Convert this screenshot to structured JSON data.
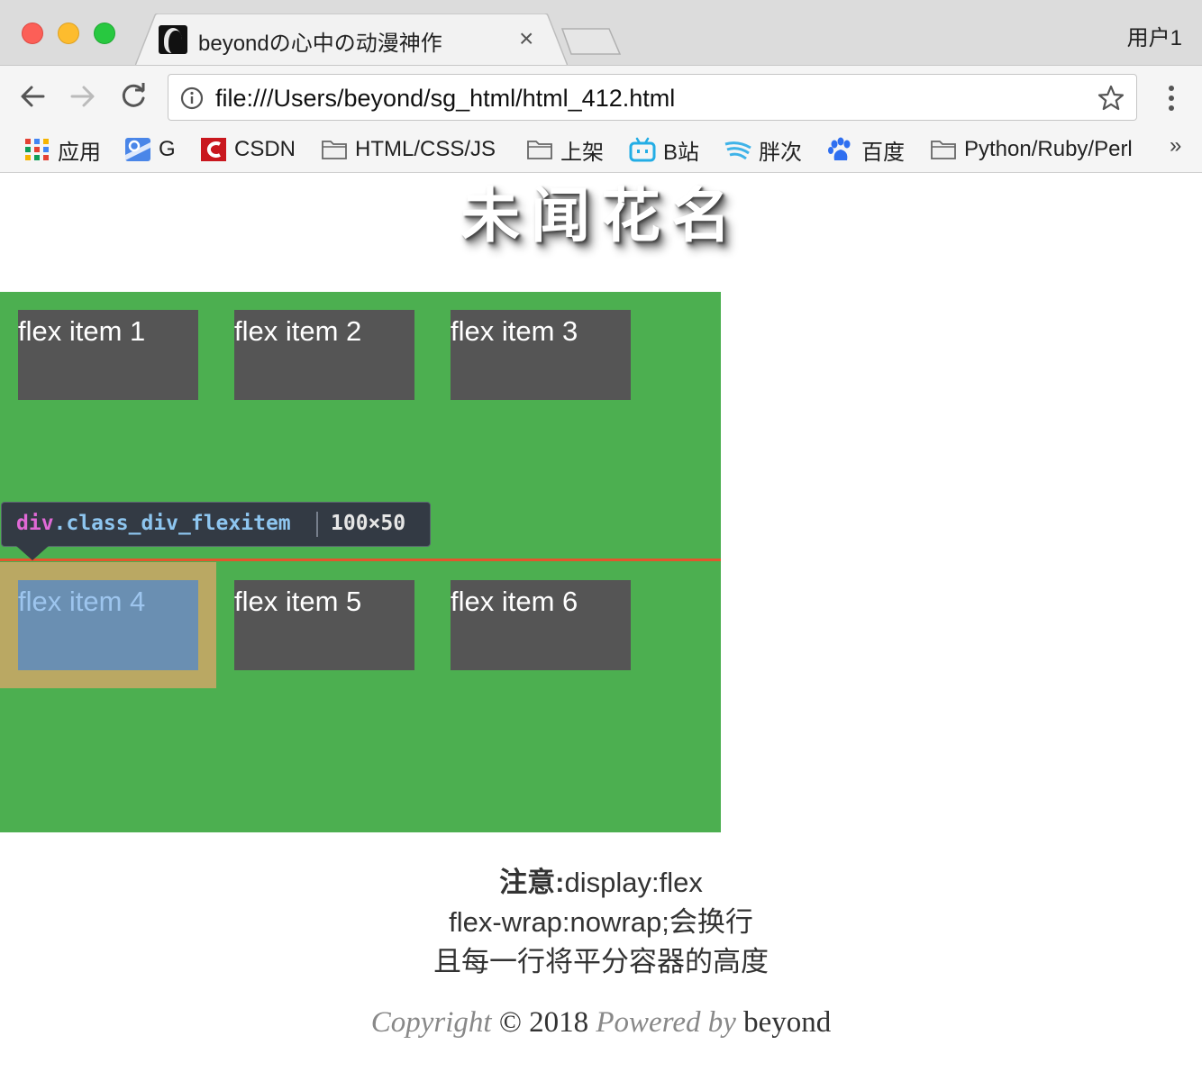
{
  "browser": {
    "tab_title": "beyondの心中の动漫神作",
    "tab_close_glyph": "×",
    "profile_name": "用户1",
    "url": "file:///Users/beyond/sg_html/html_412.html",
    "more_bookmarks_glyph": "»",
    "bookmarks": [
      {
        "label": "应用",
        "icon": "apps-grid-icon"
      },
      {
        "label": "G",
        "icon": "google-maps-icon"
      },
      {
        "label": "CSDN",
        "icon": "csdn-icon"
      },
      {
        "label": "HTML/CSS/JS",
        "icon": "folder-icon"
      },
      {
        "label": "上架",
        "icon": "folder-icon"
      },
      {
        "label": "B站",
        "icon": "bilibili-icon"
      },
      {
        "label": "胖次",
        "icon": "wave-icon"
      },
      {
        "label": "百度",
        "icon": "baidu-paw-icon"
      },
      {
        "label": "Python/Ruby/Perl",
        "icon": "folder-icon"
      }
    ]
  },
  "page": {
    "title": "未闻花名",
    "flex_items": [
      {
        "label": "flex item 1"
      },
      {
        "label": "flex item 2"
      },
      {
        "label": "flex item 3"
      },
      {
        "label": "flex item 4"
      },
      {
        "label": "flex item 5"
      },
      {
        "label": "flex item 6"
      }
    ],
    "tooltip": {
      "tag": "div",
      "class_name": ".class_div_flexitem",
      "size": "100×50"
    },
    "note": {
      "label": "注意:",
      "line1_rest": "display:flex",
      "line2": "flex-wrap:nowrap;会换行",
      "line3": "且每一行将平分容器的高度"
    },
    "footer": {
      "copyright_word": "Copyright",
      "copyright_year": "© 2018",
      "powered_by": "Powered by",
      "author": "beyond"
    }
  },
  "colors": {
    "container_bg": "#4caf50",
    "item_bg": "#555555",
    "highlight_margin": "#baa863",
    "highlight_content": "#6a8fb2"
  }
}
